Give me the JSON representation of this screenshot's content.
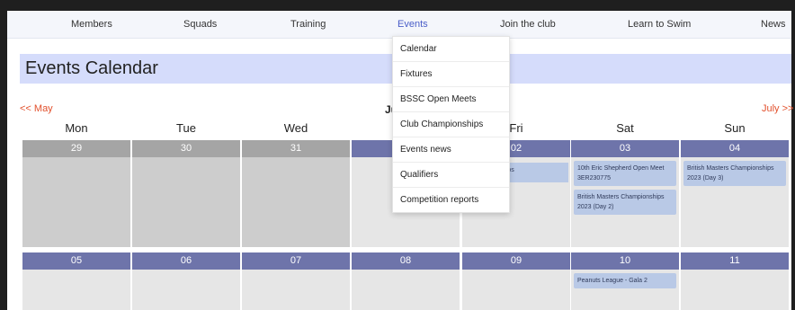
{
  "nav": {
    "items": [
      {
        "label": "Members"
      },
      {
        "label": "Squads"
      },
      {
        "label": "Training"
      },
      {
        "label": "Events"
      },
      {
        "label": "Join the club"
      },
      {
        "label": "Learn to Swim"
      },
      {
        "label": "News"
      }
    ],
    "active_index": 3,
    "active_color": "#4a5ec8"
  },
  "events_menu": [
    {
      "label": "Calendar"
    },
    {
      "label": "Fixtures"
    },
    {
      "label": "BSSC Open Meets"
    },
    {
      "label": "Club Championships"
    },
    {
      "label": "Events news"
    },
    {
      "label": "Qualifiers"
    },
    {
      "label": "Competition reports"
    }
  ],
  "page_title": "Events Calendar",
  "month_nav": {
    "prev": "<< May",
    "current_partial": "Ju",
    "next": "July >>"
  },
  "weekdays": [
    "Mon",
    "Tue",
    "Wed",
    "Thu",
    "Fri",
    "Sat",
    "Sun"
  ],
  "weeks": [
    {
      "days": [
        {
          "date": "29",
          "past": true,
          "events": []
        },
        {
          "date": "30",
          "past": true,
          "events": []
        },
        {
          "date": "31",
          "past": true,
          "events": []
        },
        {
          "date": "",
          "past": false,
          "events": []
        },
        {
          "date": "02",
          "past": false,
          "events": []
        },
        {
          "date": "03",
          "past": false,
          "events": [
            "10th Eric Shepherd Open Meet 3ER230775",
            "British Masters Championships 2023 (Day 2)"
          ]
        },
        {
          "date": "04",
          "past": false,
          "events": [
            "British Masters Championships 2023 (Day 3)"
          ]
        }
      ]
    },
    {
      "days": [
        {
          "date": "05",
          "past": false,
          "events": []
        },
        {
          "date": "06",
          "past": false,
          "events": []
        },
        {
          "date": "07",
          "past": false,
          "events": []
        },
        {
          "date": "08",
          "past": false,
          "events": []
        },
        {
          "date": "09",
          "past": false,
          "events": []
        },
        {
          "date": "10",
          "past": false,
          "events": [
            "Peanuts League - Gala 2"
          ]
        },
        {
          "date": "11",
          "past": false,
          "events": []
        }
      ]
    }
  ],
  "partial_event_fri": "s Championships",
  "colors": {
    "title_bar": "#d5dcfb",
    "day_header": "#6e74aa",
    "past_header": "#a5a5a5",
    "event": "#b9c9e6",
    "month_link": "#e2502c"
  }
}
